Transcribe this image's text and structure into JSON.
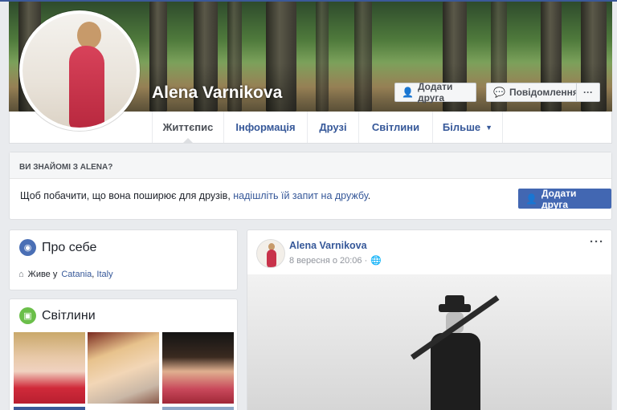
{
  "profile": {
    "name": "Alena Varnikova",
    "add_friend_label": "Додати друга",
    "message_label": "Повідомлення",
    "more_label": "···"
  },
  "tabs": [
    {
      "label": "Життєпис"
    },
    {
      "label": "Інформація"
    },
    {
      "label": "Друзі"
    },
    {
      "label": "Світлини"
    },
    {
      "label": "Більше"
    }
  ],
  "know": {
    "heading": "ВИ ЗНАЙОМІ З ALENA?",
    "text_before": "Щоб побачити, що вона поширює для друзів, ",
    "link": "надішліть їй запит на дружбу",
    "text_after": ".",
    "button_label": "Додати друга"
  },
  "about": {
    "title": "Про себе",
    "lives_prefix": "Живе у",
    "city": "Catania",
    "country": "Italy"
  },
  "photos": {
    "title": "Світлини"
  },
  "post": {
    "author": "Alena Varnikova",
    "date": "8 вересня о 20:06 ·",
    "options_label": "···"
  },
  "colors": {
    "brand_blue": "#4267b2",
    "link_blue": "#365899",
    "background": "#e9ebee"
  },
  "icons": {
    "add_friend": "person-plus-icon",
    "messenger": "messenger-icon",
    "about": "globe-icon",
    "photos": "image-icon",
    "home": "house-icon",
    "privacy": "public-globe-icon"
  }
}
